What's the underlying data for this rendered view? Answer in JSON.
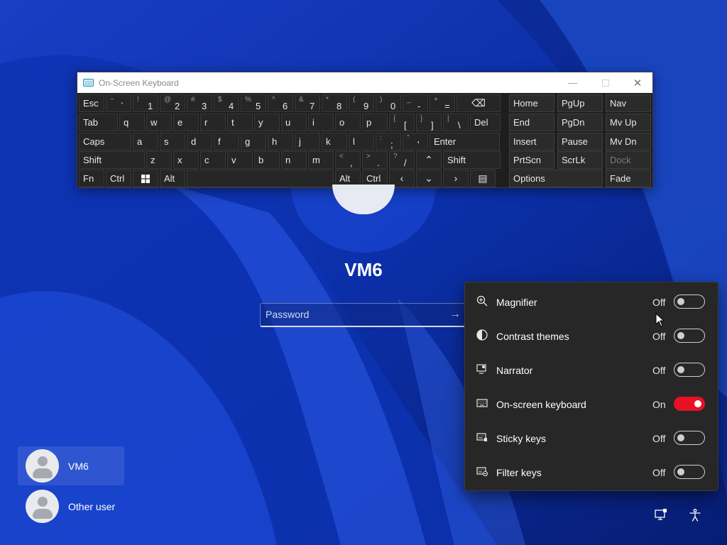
{
  "osk": {
    "title": "On-Screen Keyboard",
    "rows": [
      [
        {
          "t": "Esc",
          "w": 36
        },
        {
          "s": "~",
          "p": "`",
          "w": 36
        },
        {
          "s": "!",
          "p": "1",
          "w": 36
        },
        {
          "s": "@",
          "p": "2",
          "w": 36
        },
        {
          "s": "#",
          "p": "3",
          "w": 36
        },
        {
          "s": "$",
          "p": "4",
          "w": 36
        },
        {
          "s": "%",
          "p": "5",
          "w": 36
        },
        {
          "s": "^",
          "p": "6",
          "w": 36
        },
        {
          "s": "&",
          "p": "7",
          "w": 36
        },
        {
          "s": "*",
          "p": "8",
          "w": 36
        },
        {
          "s": "(",
          "p": "9",
          "w": 36
        },
        {
          "s": ")",
          "p": "0",
          "w": 36
        },
        {
          "s": "_",
          "p": "-",
          "w": 36
        },
        {
          "s": "+",
          "p": "=",
          "w": 36
        },
        {
          "icon": "backspace-icon",
          "c": "⌫",
          "w": 62
        }
      ],
      [
        {
          "t": "Tab",
          "w": 55
        },
        {
          "t": "q"
        },
        {
          "t": "w"
        },
        {
          "t": "e"
        },
        {
          "t": "r"
        },
        {
          "t": "t"
        },
        {
          "t": "y"
        },
        {
          "t": "u"
        },
        {
          "t": "i"
        },
        {
          "t": "o"
        },
        {
          "t": "p"
        },
        {
          "s": "{",
          "p": "["
        },
        {
          "s": "}",
          "p": "]"
        },
        {
          "s": "|",
          "p": "\\"
        },
        {
          "t": "Del",
          "w": 43
        }
      ],
      [
        {
          "t": "Caps",
          "w": 74
        },
        {
          "t": "a"
        },
        {
          "t": "s"
        },
        {
          "t": "d"
        },
        {
          "t": "f"
        },
        {
          "t": "g"
        },
        {
          "t": "h"
        },
        {
          "t": "j"
        },
        {
          "t": "k"
        },
        {
          "t": "l"
        },
        {
          "s": ":",
          "p": ";"
        },
        {
          "s": "\"",
          "p": "'"
        },
        {
          "t": "Enter",
          "w": 99
        }
      ],
      [
        {
          "t": "Shift",
          "w": 93
        },
        {
          "t": "z"
        },
        {
          "t": "x"
        },
        {
          "t": "c"
        },
        {
          "t": "v"
        },
        {
          "t": "b"
        },
        {
          "t": "n"
        },
        {
          "t": "m"
        },
        {
          "s": "<",
          "p": ","
        },
        {
          "s": ">",
          "p": "."
        },
        {
          "s": "?",
          "p": "/"
        },
        {
          "icon": "arrow-up-icon",
          "c": "⌃"
        },
        {
          "t": "Shift",
          "w": 81
        }
      ],
      [
        {
          "t": "Fn",
          "w": 36
        },
        {
          "t": "Ctrl",
          "w": 36
        },
        {
          "icon": "windows-logo-icon",
          "c": "win",
          "w": 36
        },
        {
          "t": "Alt",
          "w": 36
        },
        {
          "t": "",
          "w": 207
        },
        {
          "t": "Alt",
          "w": 36
        },
        {
          "t": "Ctrl",
          "w": 36
        },
        {
          "icon": "arrow-left-icon",
          "c": "‹"
        },
        {
          "icon": "arrow-down-icon",
          "c": "⌄"
        },
        {
          "icon": "arrow-right-icon",
          "c": "›"
        },
        {
          "icon": "menu-key-icon",
          "c": "▤"
        }
      ]
    ],
    "nav_rows": [
      [
        "Home",
        "PgUp",
        "Nav"
      ],
      [
        "End",
        "PgDn",
        "Mv Up"
      ],
      [
        "Insert",
        "Pause",
        "Mv Dn"
      ],
      [
        "PrtScn",
        "ScrLk",
        "Dock"
      ],
      [
        "Options",
        "Fade"
      ]
    ]
  },
  "login": {
    "username": "VM6",
    "password_placeholder": "Password"
  },
  "users": [
    {
      "name": "VM6",
      "selected": true
    },
    {
      "name": "Other user",
      "selected": false
    }
  ],
  "accessibility": [
    {
      "label": "Magnifier",
      "state": "Off",
      "on": false,
      "icon": "magnifier-icon"
    },
    {
      "label": "Contrast themes",
      "state": "Off",
      "on": false,
      "icon": "contrast-icon"
    },
    {
      "label": "Narrator",
      "state": "Off",
      "on": false,
      "icon": "narrator-icon"
    },
    {
      "label": "On-screen keyboard",
      "state": "On",
      "on": true,
      "icon": "keyboard-icon"
    },
    {
      "label": "Sticky keys",
      "state": "Off",
      "on": false,
      "icon": "sticky-keys-icon"
    },
    {
      "label": "Filter keys",
      "state": "Off",
      "on": false,
      "icon": "filter-keys-icon"
    }
  ],
  "colors": {
    "accent": "#e81123",
    "wallpaper": "#0a2a9c",
    "flyout_bg": "#272727",
    "key_bg": "#262626"
  }
}
